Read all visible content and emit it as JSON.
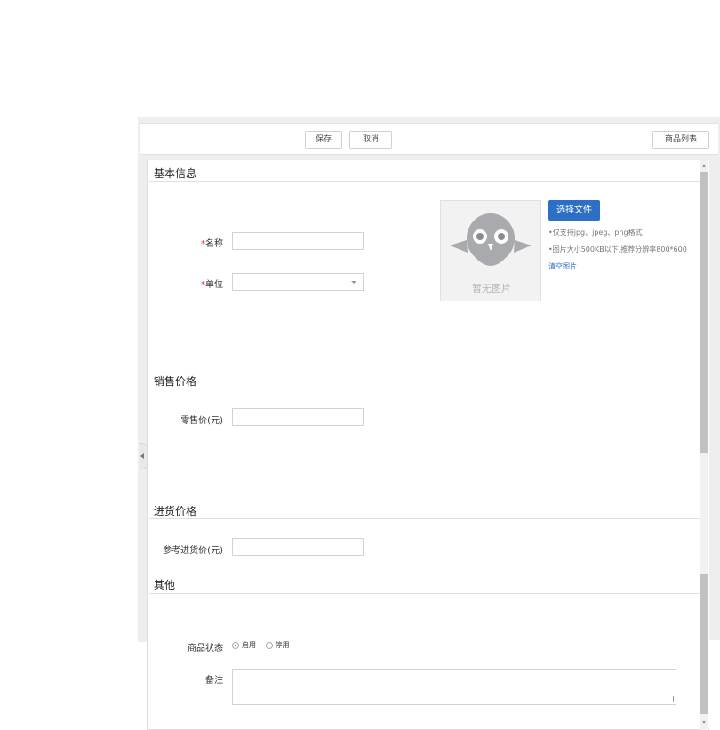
{
  "toolbar": {
    "save": "保存",
    "cancel": "取消",
    "product_list": "商品列表"
  },
  "sections": {
    "basic": "基本信息",
    "sale_price": "销售价格",
    "purchase_price": "进货价格",
    "other": "其他"
  },
  "fields": {
    "required_mark": "*",
    "name_label": "名称",
    "unit_label": "单位",
    "retail_price_label": "零售价(元)",
    "ref_purchase_price_label": "参考进货价(元)",
    "status_label": "商品状态",
    "remark_label": "备注",
    "name_value": "",
    "unit_value": "",
    "retail_price_value": "",
    "ref_purchase_price_value": "",
    "remark_value": ""
  },
  "image": {
    "placeholder_caption": "暂无图片",
    "choose_button": "选择文件",
    "tip_format": "•仅支持jpg、jpeg、png格式",
    "tip_size": "•图片大小500KB以下,推荐分辨率800*600",
    "clear": "清空图片"
  },
  "status": {
    "options": [
      "启用",
      "停用"
    ],
    "selected": "启用"
  },
  "colors": {
    "primary": "#2d6fc6",
    "required": "#e0302c"
  },
  "icons": {
    "placeholder": "owl-placeholder-icon",
    "collapse": "chevron-left-icon"
  }
}
